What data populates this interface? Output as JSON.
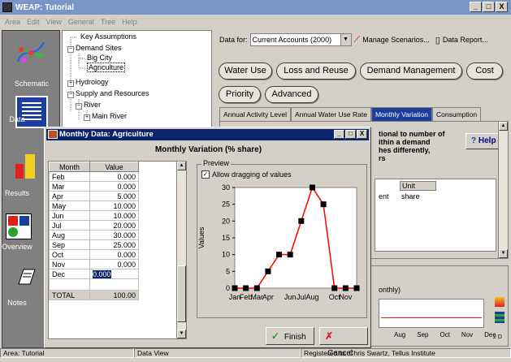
{
  "window": {
    "title": "WEAP: Tutorial",
    "min": "_",
    "max": "□",
    "close": "X"
  },
  "menu": [
    "Area",
    "Edit",
    "View",
    "General",
    "Tree",
    "Help"
  ],
  "views": [
    {
      "label": "Schematic",
      "icon": "schematic-icon"
    },
    {
      "label": "Data",
      "icon": "data-icon"
    },
    {
      "label": "Results",
      "icon": "results-icon"
    },
    {
      "label": "Overview",
      "icon": "overview-icon"
    },
    {
      "label": "Notes",
      "icon": "notes-icon"
    }
  ],
  "tree": {
    "nodes": [
      {
        "label": "Key Assumptions",
        "prefix": ""
      },
      {
        "label": "Demand Sites",
        "prefix": "−"
      },
      {
        "label": "Big City",
        "prefix": ""
      },
      {
        "label": "Agriculture",
        "prefix": ""
      },
      {
        "label": "Hydrology",
        "prefix": "+"
      },
      {
        "label": "Supply and Resources",
        "prefix": "−"
      },
      {
        "label": "River",
        "prefix": "−"
      },
      {
        "label": "Main River",
        "prefix": "+"
      }
    ]
  },
  "data_for": {
    "label": "Data for:",
    "value": "Current Accounts (2000)",
    "manage": "Manage Scenarios...",
    "report": "Data Report..."
  },
  "categories": [
    "Water Use",
    "Loss and Reuse",
    "Demand Management",
    "Cost",
    "Priority",
    "Advanced"
  ],
  "tabs": [
    "Annual Activity Level",
    "Annual Water Use Rate",
    "Monthly Variation",
    "Consumption"
  ],
  "help": {
    "label": "Help",
    "text": [
      "tional to number of",
      "ithin a demand",
      "hes differently,",
      "rs"
    ]
  },
  "unit_table": {
    "header": "Unit",
    "col0": "ent",
    "value": "share"
  },
  "bg_chart": {
    "label": "onthly)",
    "months": [
      "Aug",
      "Sep",
      "Oct",
      "Nov",
      "Dec"
    ],
    "corner": "2 D"
  },
  "dialog": {
    "title": "Monthly Data: Agriculture",
    "heading": "Monthly Variation (% share)",
    "col_month": "Month",
    "col_value": "Value",
    "rows": [
      {
        "m": "Feb",
        "v": "0.000"
      },
      {
        "m": "Mar",
        "v": "0.000"
      },
      {
        "m": "Apr",
        "v": "5.000"
      },
      {
        "m": "May",
        "v": "10.000"
      },
      {
        "m": "Jun",
        "v": "10.000"
      },
      {
        "m": "Jul",
        "v": "20.000"
      },
      {
        "m": "Aug",
        "v": "30.000"
      },
      {
        "m": "Sep",
        "v": "25.000"
      },
      {
        "m": "Oct",
        "v": "0.000"
      },
      {
        "m": "Nov",
        "v": "0.000"
      },
      {
        "m": "Dec",
        "v": "0.000"
      }
    ],
    "total_label": "TOTAL",
    "total_value": "100.00",
    "preview_label": "Preview",
    "drag_label": "Allow dragging of values",
    "finish": "Finish",
    "cancel": "Cancel"
  },
  "chart_data": {
    "type": "line",
    "ylabel": "Values",
    "ylim": [
      0,
      30
    ],
    "yticks": [
      0,
      5,
      10,
      15,
      20,
      25,
      30
    ],
    "categories": [
      "Jan",
      "Feb",
      "Mar",
      "Apr",
      "May",
      "Jun",
      "Jul",
      "Aug",
      "Sep",
      "Oct",
      "Nov",
      "Dec"
    ],
    "tick_labels": [
      "Jan",
      "Feb",
      "Mar",
      "Apr",
      "",
      "Jun",
      "Jul",
      "Aug",
      "",
      "Oct",
      "Nov",
      ""
    ],
    "values": [
      0,
      0,
      0,
      5,
      10,
      10,
      20,
      30,
      25,
      0,
      0,
      0
    ],
    "line_color": "#ff0000",
    "marker_color": "#000000"
  },
  "status": {
    "area": "Area: Tutorial",
    "view": "Data View",
    "reg": "Registered to: Chris Swartz, Tellus Institute"
  },
  "colors": {
    "active_tab": "#1c3e9c",
    "dialog_title": "#0a246a"
  }
}
